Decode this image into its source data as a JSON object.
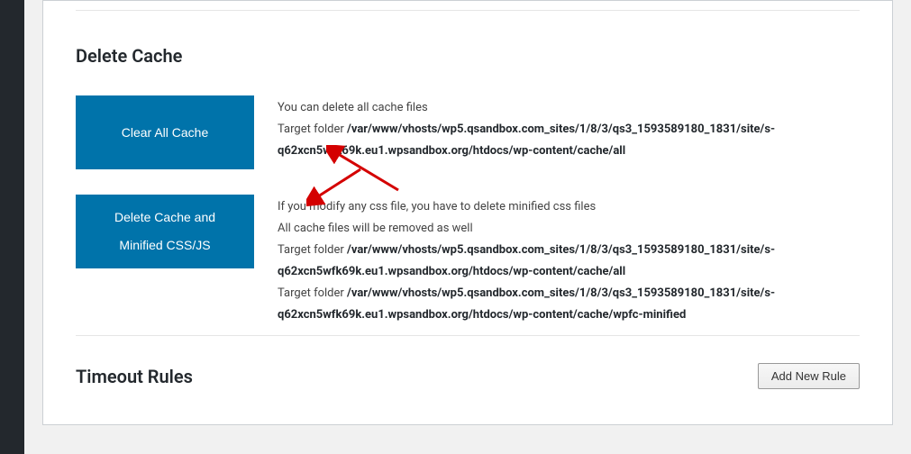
{
  "sections": {
    "delete_cache": {
      "heading": "Delete Cache",
      "clear_all": {
        "button": "Clear All Cache",
        "desc1": "You can delete all cache files",
        "target_label": "Target folder ",
        "target_path": "/var/www/vhosts/wp5.qsandbox.com_sites/1/8/3/qs3_1593589180_1831/site/s-q62xcn5wfk69k.eu1.wpsandbox.org/htdocs/wp-content/cache/all"
      },
      "delete_minified": {
        "button_line1": "Delete Cache and",
        "button_line2": "Minified CSS/JS",
        "desc1": "If you modify any css file, you have to delete minified css files",
        "desc2": "All cache files will be removed as well",
        "target_label1": "Target folder ",
        "target_path1": "/var/www/vhosts/wp5.qsandbox.com_sites/1/8/3/qs3_1593589180_1831/site/s-q62xcn5wfk69k.eu1.wpsandbox.org/htdocs/wp-content/cache/all",
        "target_label2": "Target folder ",
        "target_path2": "/var/www/vhosts/wp5.qsandbox.com_sites/1/8/3/qs3_1593589180_1831/site/s-q62xcn5wfk69k.eu1.wpsandbox.org/htdocs/wp-content/cache/wpfc-minified"
      }
    },
    "timeout_rules": {
      "heading": "Timeout Rules",
      "add_button": "Add New Rule"
    }
  }
}
